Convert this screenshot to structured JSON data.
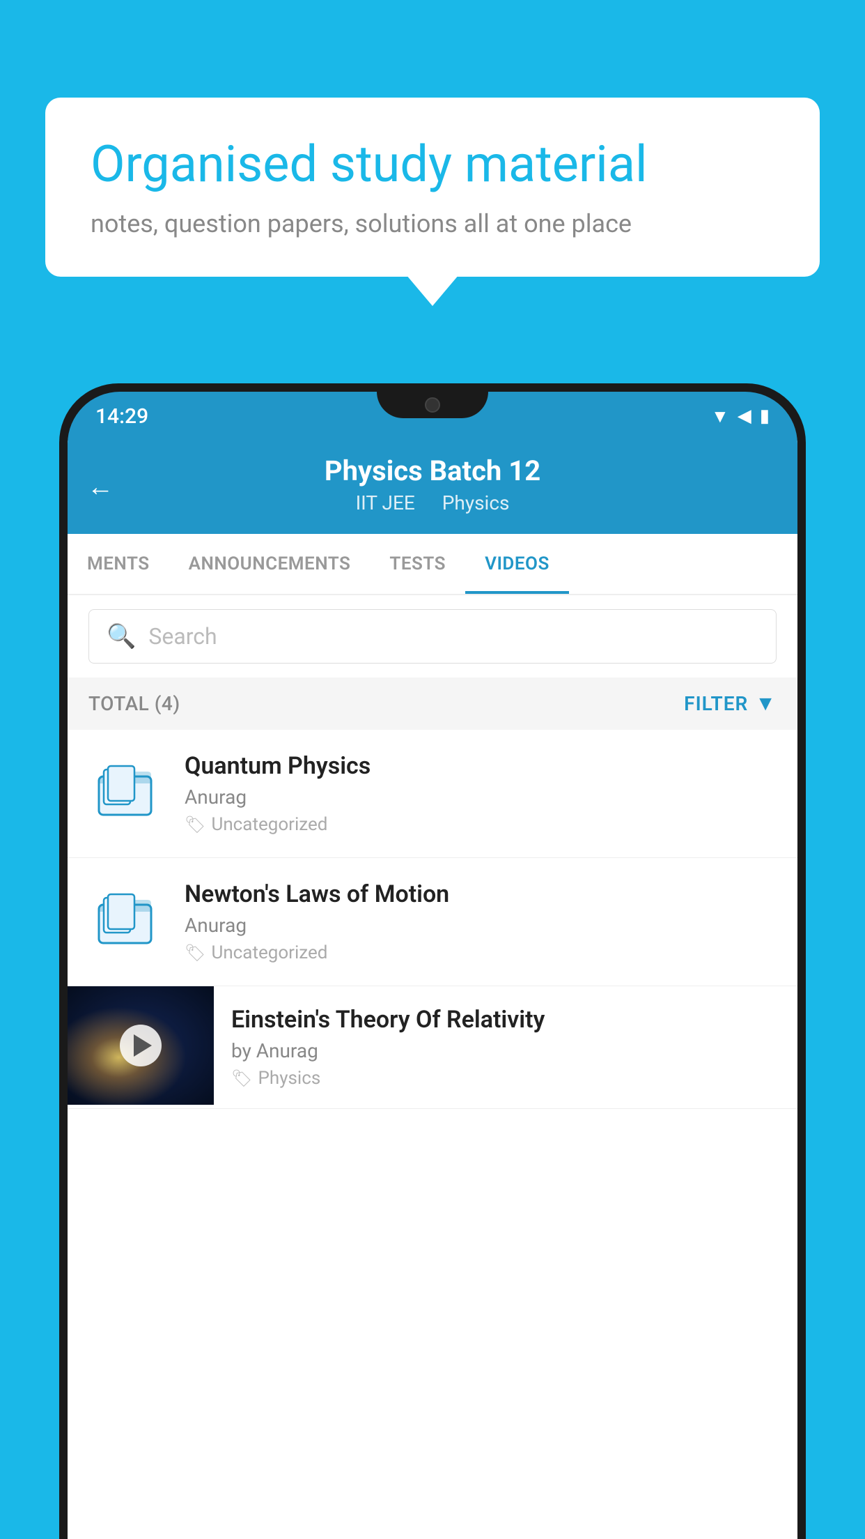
{
  "background_color": "#1ab8e8",
  "speech_bubble": {
    "title": "Organised study material",
    "subtitle": "notes, question papers, solutions all at one place"
  },
  "phone": {
    "status_bar": {
      "time": "14:29",
      "icons": [
        "wifi",
        "signal",
        "battery"
      ]
    },
    "header": {
      "title": "Physics Batch 12",
      "subtitle_parts": [
        "IIT JEE",
        "Physics"
      ],
      "back_label": "←"
    },
    "tabs": [
      {
        "label": "MENTS",
        "active": false
      },
      {
        "label": "ANNOUNCEMENTS",
        "active": false
      },
      {
        "label": "TESTS",
        "active": false
      },
      {
        "label": "VIDEOS",
        "active": true
      }
    ],
    "search": {
      "placeholder": "Search"
    },
    "filter_bar": {
      "total_label": "TOTAL (4)",
      "filter_label": "FILTER"
    },
    "videos": [
      {
        "id": 1,
        "type": "folder",
        "title": "Quantum Physics",
        "author": "Anurag",
        "tag": "Uncategorized"
      },
      {
        "id": 2,
        "type": "folder",
        "title": "Newton's Laws of Motion",
        "author": "Anurag",
        "tag": "Uncategorized"
      },
      {
        "id": 3,
        "type": "video",
        "title": "Einstein's Theory Of Relativity",
        "author": "by Anurag",
        "tag": "Physics"
      }
    ]
  }
}
